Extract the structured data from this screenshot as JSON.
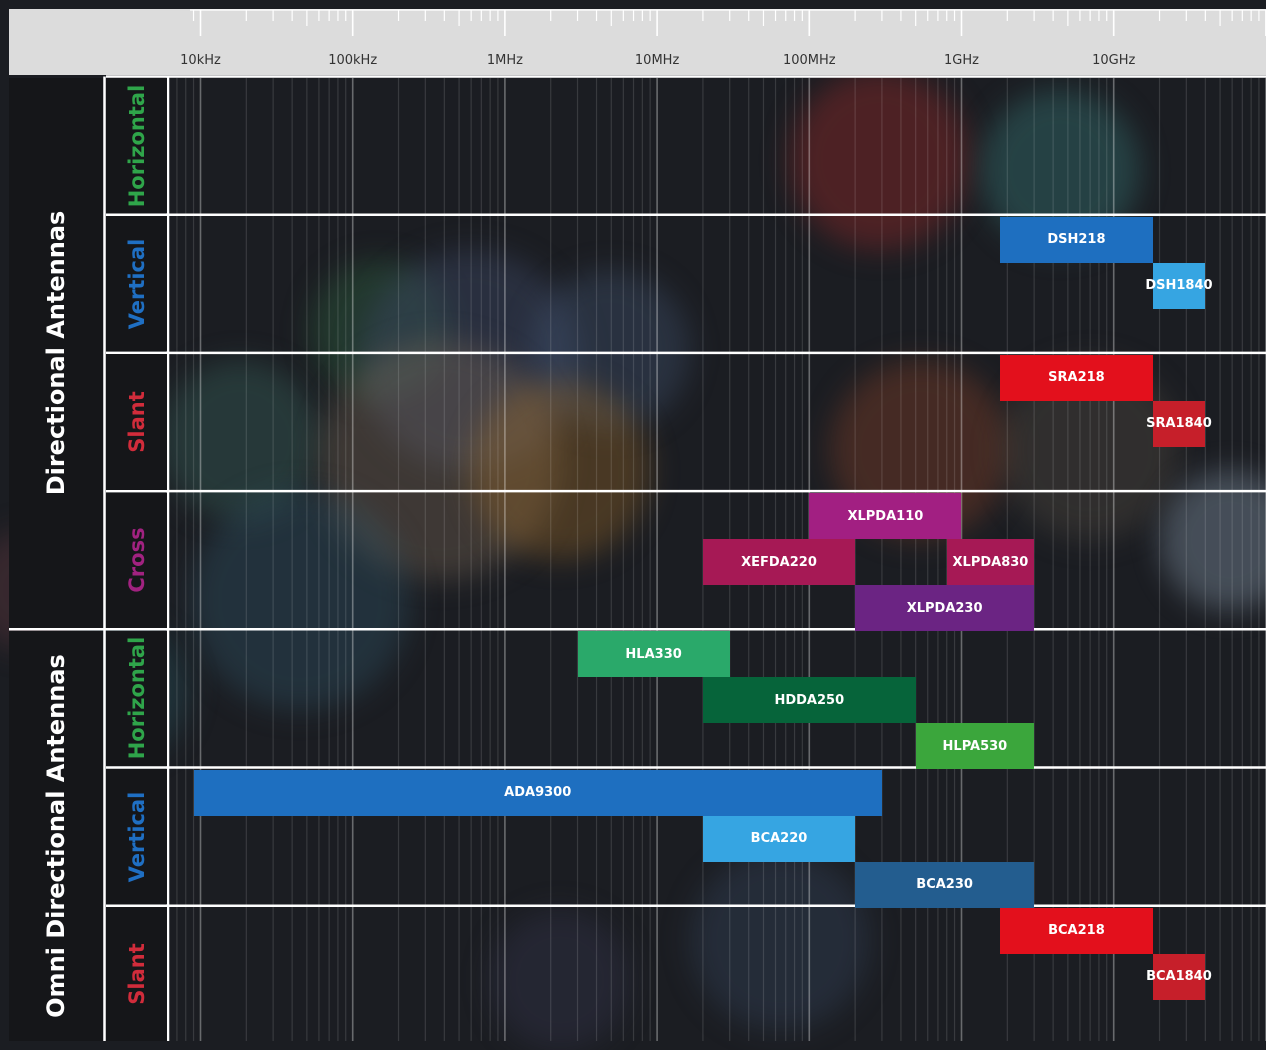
{
  "chart_data": {
    "type": "bar",
    "orientation": "horizontal",
    "x_scale": "log",
    "x_unit": "Hz",
    "x_ticks": [
      {
        "label": "10kHz",
        "value": 10000
      },
      {
        "label": "100kHz",
        "value": 100000
      },
      {
        "label": "1MHz",
        "value": 1000000
      },
      {
        "label": "10MHz",
        "value": 10000000
      },
      {
        "label": "100MHz",
        "value": 100000000
      },
      {
        "label": "1GHz",
        "value": 1000000000
      },
      {
        "label": "10GHz",
        "value": 10000000000
      }
    ],
    "xlim": [
      6000,
      130000000000
    ],
    "groups": [
      {
        "label": "Directional Antennas",
        "rows": [
          {
            "label": "Horizontal",
            "color": "#2fa54a"
          },
          {
            "label": "Vertical",
            "color": "#1f6fc3"
          },
          {
            "label": "Slant",
            "color": "#d12c3b"
          },
          {
            "label": "Cross",
            "color": "#a12280"
          }
        ]
      },
      {
        "label": "Omni Directional Antennas",
        "rows": [
          {
            "label": "Horizontal",
            "color": "#2fa54a"
          },
          {
            "label": "Vertical",
            "color": "#1f6fc3"
          },
          {
            "label": "Slant",
            "color": "#d12c3b"
          }
        ]
      }
    ],
    "series": [
      {
        "name": "DSH218",
        "row": 1,
        "lane": 0,
        "x_start": 1800000000,
        "x_end": 18000000000,
        "color": "#1e6fc0"
      },
      {
        "name": "DSH1840",
        "row": 1,
        "lane": 1,
        "x_start": 18000000000,
        "x_end": 40000000000,
        "color": "#36a5e2"
      },
      {
        "name": "SRA218",
        "row": 2,
        "lane": 0,
        "x_start": 1800000000,
        "x_end": 18000000000,
        "color": "#e3101c"
      },
      {
        "name": "SRA1840",
        "row": 2,
        "lane": 1,
        "x_start": 18000000000,
        "x_end": 40000000000,
        "color": "#c61f2a"
      },
      {
        "name": "XLPDA110",
        "row": 3,
        "lane": 0,
        "x_start": 100000000,
        "x_end": 1000000000,
        "color": "#a21f82"
      },
      {
        "name": "XEFDA220",
        "row": 3,
        "lane": 1,
        "x_start": 20000000,
        "x_end": 200000000,
        "color": "#a61955"
      },
      {
        "name": "XLPDA830",
        "row": 3,
        "lane": 1,
        "x_start": 800000000,
        "x_end": 3000000000,
        "color": "#a61955"
      },
      {
        "name": "XLPDA230",
        "row": 3,
        "lane": 2,
        "x_start": 200000000,
        "x_end": 3000000000,
        "color": "#6b2483"
      },
      {
        "name": "HLA330",
        "row": 4,
        "lane": 0,
        "x_start": 3000000,
        "x_end": 30000000,
        "color": "#2aa96a"
      },
      {
        "name": "HDDA250",
        "row": 4,
        "lane": 1,
        "x_start": 20000000,
        "x_end": 500000000,
        "color": "#06643a"
      },
      {
        "name": "HLPA530",
        "row": 4,
        "lane": 2,
        "x_start": 500000000,
        "x_end": 3000000000,
        "color": "#3ba63c"
      },
      {
        "name": "ADA9300",
        "row": 5,
        "lane": 0,
        "x_start": 9000,
        "x_end": 300000000,
        "color": "#1e6fc0"
      },
      {
        "name": "BCA220",
        "row": 5,
        "lane": 1,
        "x_start": 20000000,
        "x_end": 200000000,
        "color": "#36a5e2"
      },
      {
        "name": "BCA230",
        "row": 5,
        "lane": 2,
        "x_start": 200000000,
        "x_end": 3000000000,
        "color": "#235d8f"
      },
      {
        "name": "BCA218",
        "row": 6,
        "lane": 0,
        "x_start": 1800000000,
        "x_end": 18000000000,
        "color": "#e3101c"
      },
      {
        "name": "BCA1840",
        "row": 6,
        "lane": 1,
        "x_start": 18000000000,
        "x_end": 40000000000,
        "color": "#c61f2a"
      }
    ]
  }
}
